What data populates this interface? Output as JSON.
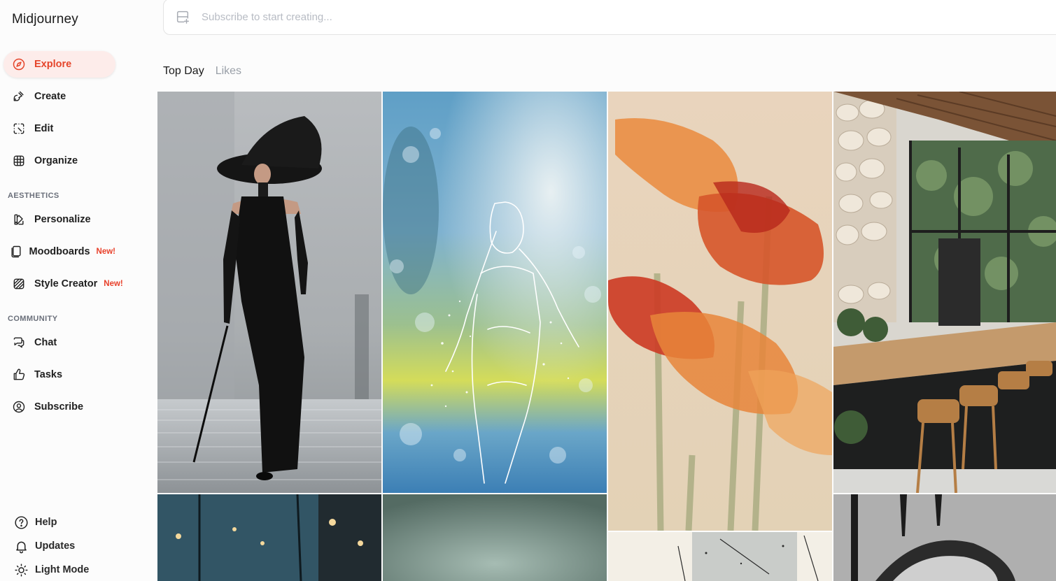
{
  "app": {
    "title": "Midjourney"
  },
  "sidebar": {
    "primary": [
      {
        "label": "Explore",
        "icon": "compass-icon",
        "active": true
      },
      {
        "label": "Create",
        "icon": "brush-icon"
      },
      {
        "label": "Edit",
        "icon": "edit-icon"
      },
      {
        "label": "Organize",
        "icon": "grid-icon"
      }
    ],
    "aesthetics_heading": "AESTHETICS",
    "aesthetics": [
      {
        "label": "Personalize",
        "icon": "personalize-icon"
      },
      {
        "label": "Moodboards",
        "icon": "moodboard-icon",
        "badge": "New!"
      },
      {
        "label": "Style Creator",
        "icon": "style-creator-icon",
        "badge": "New!"
      }
    ],
    "community_heading": "COMMUNITY",
    "community": [
      {
        "label": "Chat",
        "icon": "chat-icon"
      },
      {
        "label": "Tasks",
        "icon": "thumbs-up-icon"
      },
      {
        "label": "Subscribe",
        "icon": "user-circle-icon"
      }
    ],
    "bottom": [
      {
        "label": "Help",
        "icon": "help-icon"
      },
      {
        "label": "Updates",
        "icon": "bell-icon"
      },
      {
        "label": "Light Mode",
        "icon": "sun-icon"
      }
    ]
  },
  "prompt": {
    "placeholder": "Subscribe to start creating..."
  },
  "tabs": [
    {
      "label": "Top Day",
      "active": true
    },
    {
      "label": "Likes",
      "active": false
    }
  ],
  "colors": {
    "accent": "#e5452b",
    "accent_bg": "#fdecea"
  }
}
